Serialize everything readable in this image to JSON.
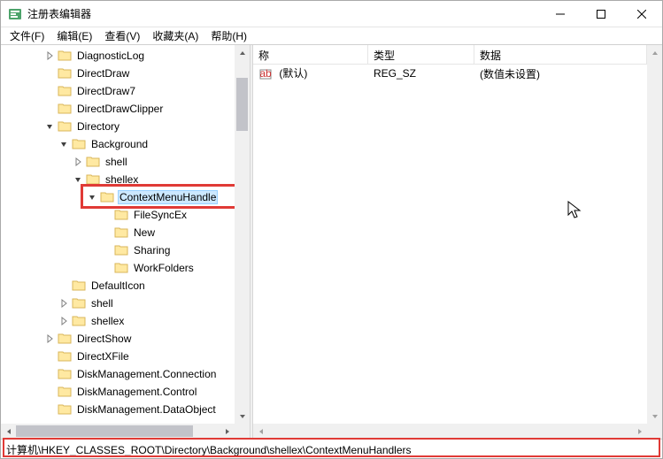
{
  "window": {
    "title": "注册表编辑器"
  },
  "menu": {
    "items": [
      "文件(F)",
      "编辑(E)",
      "查看(V)",
      "收藏夹(A)",
      "帮助(H)"
    ]
  },
  "tree": {
    "nodes": [
      {
        "label": "DiagnosticLog",
        "indent": 3,
        "exp": "closed"
      },
      {
        "label": "DirectDraw",
        "indent": 3,
        "exp": "none"
      },
      {
        "label": "DirectDraw7",
        "indent": 3,
        "exp": "none"
      },
      {
        "label": "DirectDrawClipper",
        "indent": 3,
        "exp": "none"
      },
      {
        "label": "Directory",
        "indent": 3,
        "exp": "open"
      },
      {
        "label": "Background",
        "indent": 4,
        "exp": "open"
      },
      {
        "label": "shell",
        "indent": 5,
        "exp": "closed"
      },
      {
        "label": "shellex",
        "indent": 5,
        "exp": "open"
      },
      {
        "label": "ContextMenuHandle",
        "indent": 6,
        "exp": "open",
        "selected": true
      },
      {
        "label": "FileSyncEx",
        "indent": 7,
        "exp": "none"
      },
      {
        "label": "New",
        "indent": 7,
        "exp": "none"
      },
      {
        "label": "Sharing",
        "indent": 7,
        "exp": "none"
      },
      {
        "label": "WorkFolders",
        "indent": 7,
        "exp": "none"
      },
      {
        "label": "DefaultIcon",
        "indent": 4,
        "exp": "none"
      },
      {
        "label": "shell",
        "indent": 4,
        "exp": "closed"
      },
      {
        "label": "shellex",
        "indent": 4,
        "exp": "closed"
      },
      {
        "label": "DirectShow",
        "indent": 3,
        "exp": "closed"
      },
      {
        "label": "DirectXFile",
        "indent": 3,
        "exp": "none"
      },
      {
        "label": "DiskManagement.Connection",
        "indent": 3,
        "exp": "none"
      },
      {
        "label": "DiskManagement.Control",
        "indent": 3,
        "exp": "none"
      },
      {
        "label": "DiskManagement.DataObject",
        "indent": 3,
        "exp": "none"
      }
    ]
  },
  "list": {
    "columns": {
      "name": "称",
      "type": "类型",
      "data": "数据"
    },
    "rows": [
      {
        "name": "(默认)",
        "type": "REG_SZ",
        "data": "(数值未设置)"
      }
    ]
  },
  "status": {
    "path": "计算机\\HKEY_CLASSES_ROOT\\Directory\\Background\\shellex\\ContextMenuHandlers"
  }
}
